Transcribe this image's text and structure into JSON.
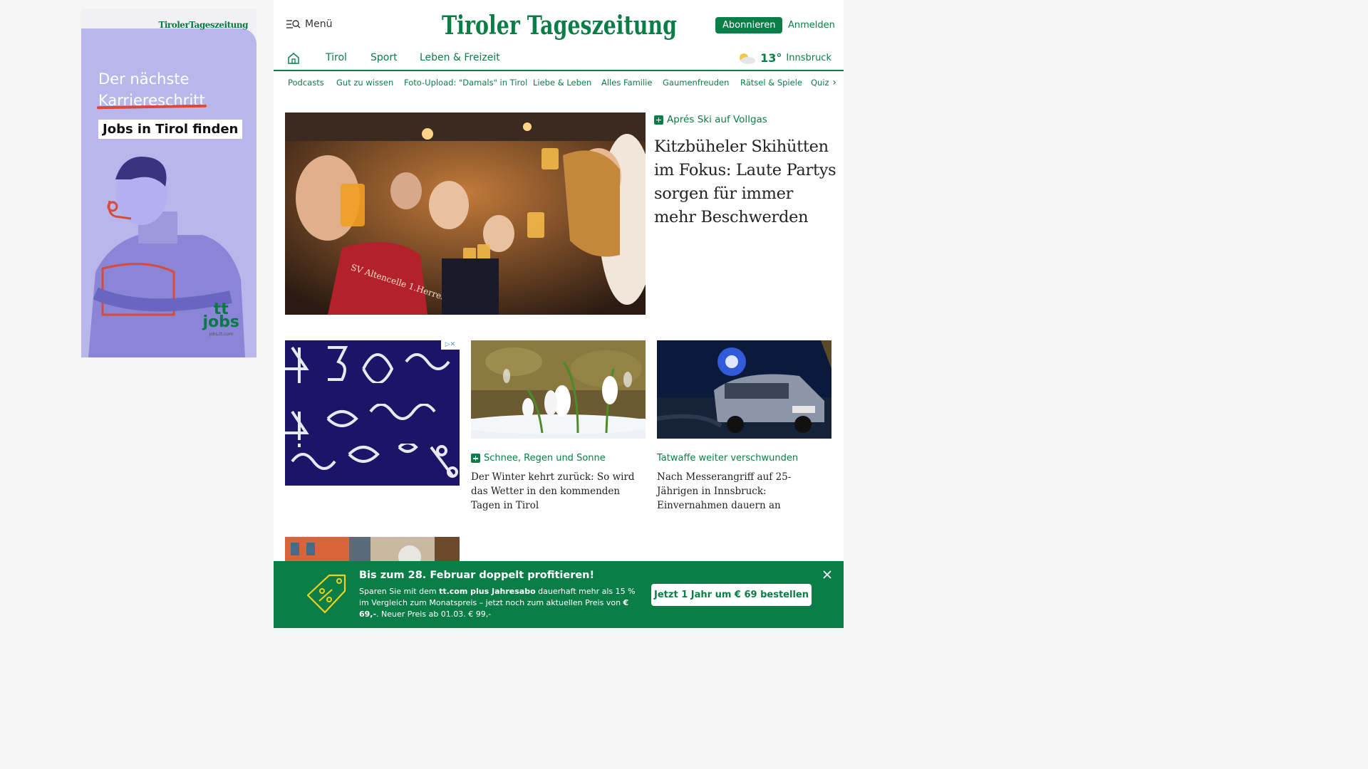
{
  "ad_side": {
    "brand": "TirolerTageszeitung",
    "headline_line1": "Der nächste",
    "headline_line2": "Karriereschritt",
    "cta": "Jobs in Tirol finden",
    "logo_top": "tt",
    "logo_bottom": "jobs",
    "logo_url": "jobs.tt.com"
  },
  "header": {
    "menu_label": "Menü",
    "logo_text": "Tiroler Tageszeitung",
    "subscribe_label": "Abonnieren",
    "login_label": "Anmelden"
  },
  "mainnav": {
    "items": [
      "Tirol",
      "Sport",
      "Leben & Freizeit"
    ],
    "weather_temp": "13°",
    "weather_city": "Innsbruck"
  },
  "subnav": {
    "items": [
      "Podcasts",
      "Gut zu wissen",
      "Foto-Upload: \"Damals\" in Tirol",
      "Liebe & Leben",
      "Alles Familie",
      "Gaumenfreuden",
      "Rätsel & Spiele",
      "Quiz"
    ]
  },
  "hero": {
    "kicker": "Aprés Ski auf Vollgas",
    "title": "Kitzbüheler Skihütten im Fokus: Laute Partys sorgen für immer mehr Beschwerden",
    "shirt_text": "SV Altencelle 1.Herren"
  },
  "cards": [
    {
      "kicker": "Schnee, Regen und Sonne",
      "premium": true,
      "title": "Der Winter kehrt zurück: So wird das Wetter in den kommenden Tagen in Tirol"
    },
    {
      "kicker": "Tatwaffe weiter verschwunden",
      "premium": false,
      "title": "Nach Messerangriff auf 25-Jährigen in Innsbruck: Einvernahmen dauern an"
    }
  ],
  "ad_card": {
    "adchoices": "▷✕"
  },
  "promo": {
    "title": "Bis zum 28. Februar doppelt profitieren!",
    "text_a": "Sparen Sie mit dem ",
    "text_b": "tt.com plus Jahresabo",
    "text_c": " dauerhaft mehr als 15 % im Vergleich zum Monatspreis – jetzt noch zum aktuellen Preis von ",
    "text_d": "€ 69,-",
    "text_e": ". Neuer Preis ab 01.03. € 99,-",
    "button": "Jetzt 1 Jahr um € 69 bestellen"
  },
  "colors": {
    "brand_green": "#0b7d47",
    "ad_lavender": "#b9b6ec"
  }
}
